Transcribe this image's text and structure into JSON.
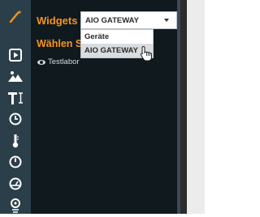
{
  "panel": {
    "title": "Widgets",
    "subtitle": "Wählen Sie",
    "tree_item": "Testlabor"
  },
  "select": {
    "value": "AIO GATEWAY",
    "options": [
      {
        "label": "Geräte"
      },
      {
        "label": "AIO GATEWAY"
      }
    ]
  },
  "rail_icons": [
    "magic-wand-icon",
    "play-icon",
    "image-icon",
    "text-icon",
    "clock-icon",
    "thermometer-icon",
    "power-icon",
    "gauge-icon",
    "location-icon"
  ],
  "colors": {
    "accent": "#f7941d",
    "rail_bg": "#2b3f4a",
    "panel_bg": "#10191e"
  }
}
